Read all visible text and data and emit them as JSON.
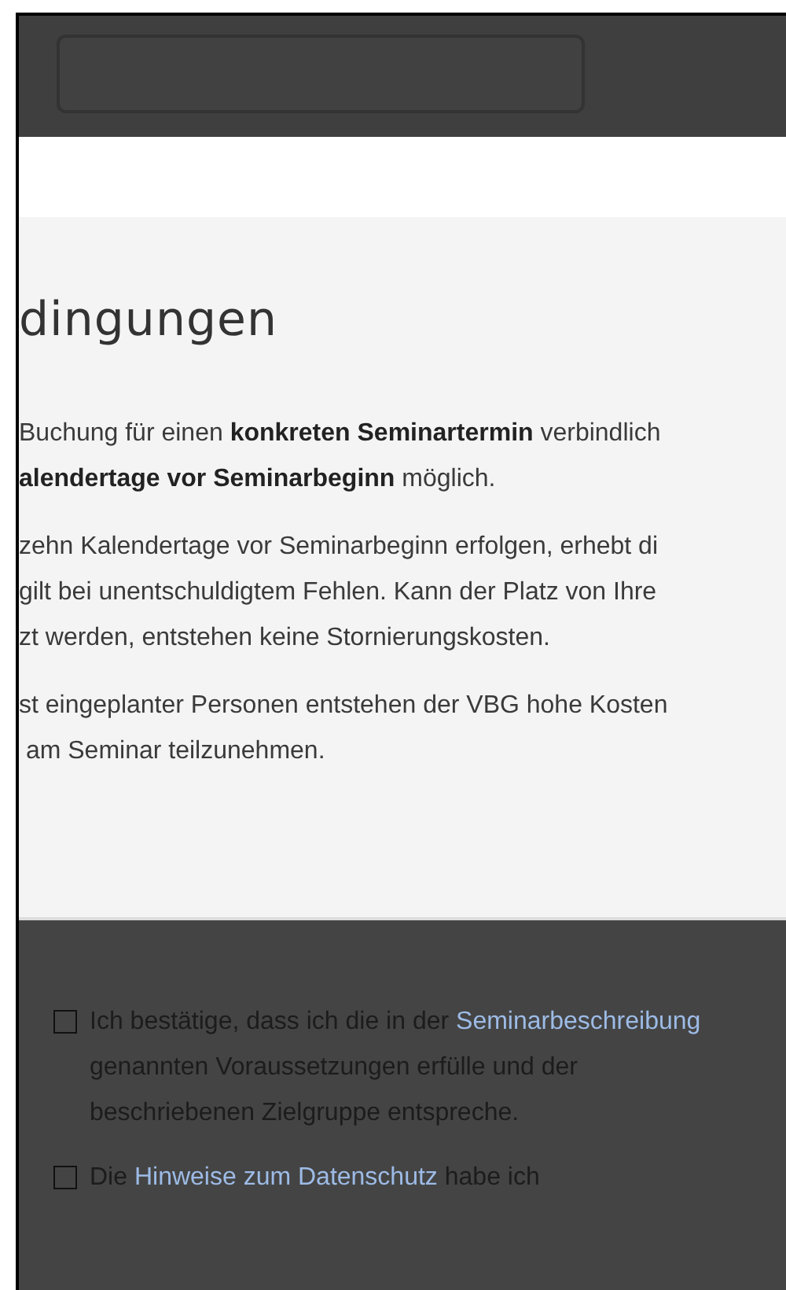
{
  "modal": {
    "heading": "dingungen",
    "paragraphs": [
      {
        "lines": [
          "Buchung für einen **konkreten Seminartermin** verbindlich",
          "**alendertage vor Seminarbeginn** möglich."
        ]
      },
      {
        "lines": [
          "zehn Kalendertage vor Seminarbeginn erfolgen, erhebt di",
          "gilt bei unentschuldigtem Fehlen. Kann der Platz von Ihre",
          "zt werden, entstehen keine Stornierungskosten."
        ]
      },
      {
        "lines": [
          "st eingeplanter Personen entstehen der VBG hohe Kosten",
          " am Seminar teilzunehmen."
        ]
      }
    ]
  },
  "consents": [
    {
      "checked": false,
      "parts": [
        {
          "kind": "plain",
          "text": "Ich bestätige, dass ich die in der "
        },
        {
          "kind": "link",
          "text": "Seminarbeschreibung"
        },
        {
          "kind": "plain",
          "text": " genannten Voraussetzungen erfülle und der beschriebenen Zielgruppe entspreche."
        }
      ]
    },
    {
      "checked": false,
      "parts": [
        {
          "kind": "plain",
          "text": "Die "
        },
        {
          "kind": "link",
          "text": "Hinweise zum Datenschutz"
        },
        {
          "kind": "plain",
          "text": " habe ich"
        }
      ]
    }
  ]
}
